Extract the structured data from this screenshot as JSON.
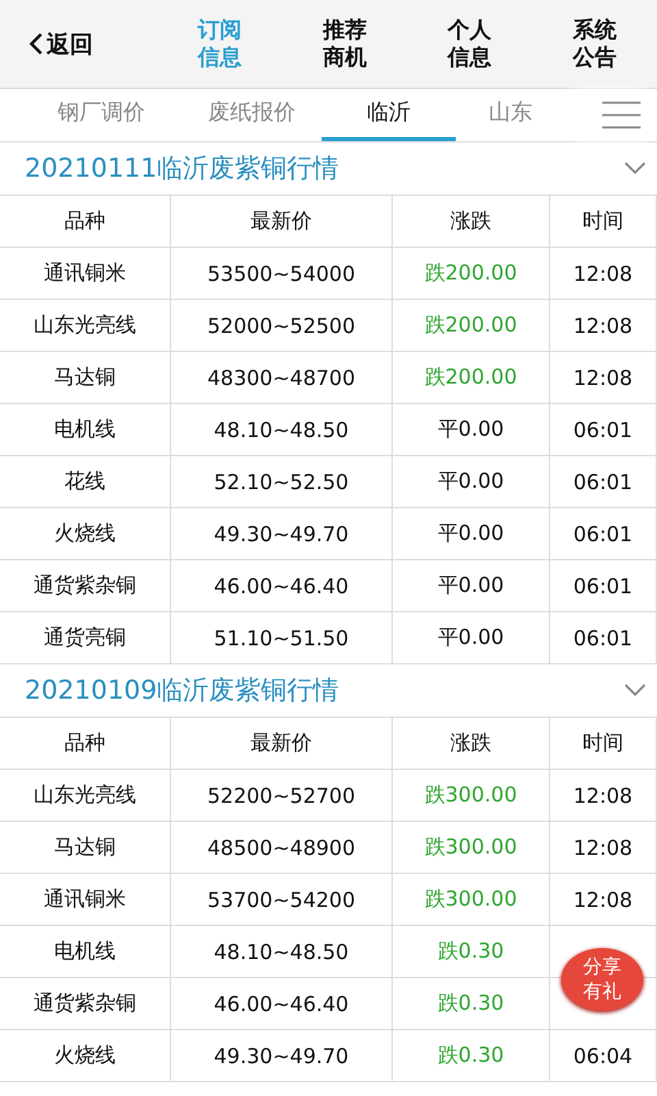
{
  "header": {
    "back": "返回",
    "nav": [
      {
        "label": "订阅信息",
        "selected": true
      },
      {
        "label": "推荐商机",
        "selected": false
      },
      {
        "label": "个人信息",
        "selected": false
      },
      {
        "label": "系统公告",
        "selected": false
      }
    ]
  },
  "tabs": [
    {
      "label": "钢厂调价",
      "selected": false
    },
    {
      "label": "废纸报价",
      "selected": false
    },
    {
      "label": "临沂",
      "selected": true
    },
    {
      "label": "山东",
      "selected": false
    }
  ],
  "sections": [
    {
      "title": "20210111临沂废紫铜行情",
      "expanded": true,
      "columns": [
        "品种",
        "最新价",
        "涨跌",
        "时间"
      ],
      "rows": [
        {
          "name": "通讯铜米",
          "price": "53500~54000",
          "change": "跌200.00",
          "kind": "down",
          "time": "12:08"
        },
        {
          "name": "山东光亮线",
          "price": "52000~52500",
          "change": "跌200.00",
          "kind": "down",
          "time": "12:08"
        },
        {
          "name": "马达铜",
          "price": "48300~48700",
          "change": "跌200.00",
          "kind": "down",
          "time": "12:08"
        },
        {
          "name": "电机线",
          "price": "48.10~48.50",
          "change": "平0.00",
          "kind": "flat",
          "time": "06:01"
        },
        {
          "name": "花线",
          "price": "52.10~52.50",
          "change": "平0.00",
          "kind": "flat",
          "time": "06:01"
        },
        {
          "name": "火烧线",
          "price": "49.30~49.70",
          "change": "平0.00",
          "kind": "flat",
          "time": "06:01"
        },
        {
          "name": "通货紫杂铜",
          "price": "46.00~46.40",
          "change": "平0.00",
          "kind": "flat",
          "time": "06:01"
        },
        {
          "name": "通货亮铜",
          "price": "51.10~51.50",
          "change": "平0.00",
          "kind": "flat",
          "time": "06:01"
        }
      ]
    },
    {
      "title": "20210109临沂废紫铜行情",
      "expanded": true,
      "columns": [
        "品种",
        "最新价",
        "涨跌",
        "时间"
      ],
      "rows": [
        {
          "name": "山东光亮线",
          "price": "52200~52700",
          "change": "跌300.00",
          "kind": "down",
          "time": "12:08"
        },
        {
          "name": "马达铜",
          "price": "48500~48900",
          "change": "跌300.00",
          "kind": "down",
          "time": "12:08"
        },
        {
          "name": "通讯铜米",
          "price": "53700~54200",
          "change": "跌300.00",
          "kind": "down",
          "time": "12:08"
        },
        {
          "name": "电机线",
          "price": "48.10~48.50",
          "change": "跌0.30",
          "kind": "down"
        },
        {
          "name": "通货紫杂铜",
          "price": "46.00~46.40",
          "change": "跌0.30",
          "kind": "down"
        },
        {
          "name": "火烧线",
          "price": "49.30~49.70",
          "change": "跌0.30",
          "kind": "down",
          "time": "06:04"
        }
      ]
    }
  ],
  "share_badge": "分享有礼"
}
